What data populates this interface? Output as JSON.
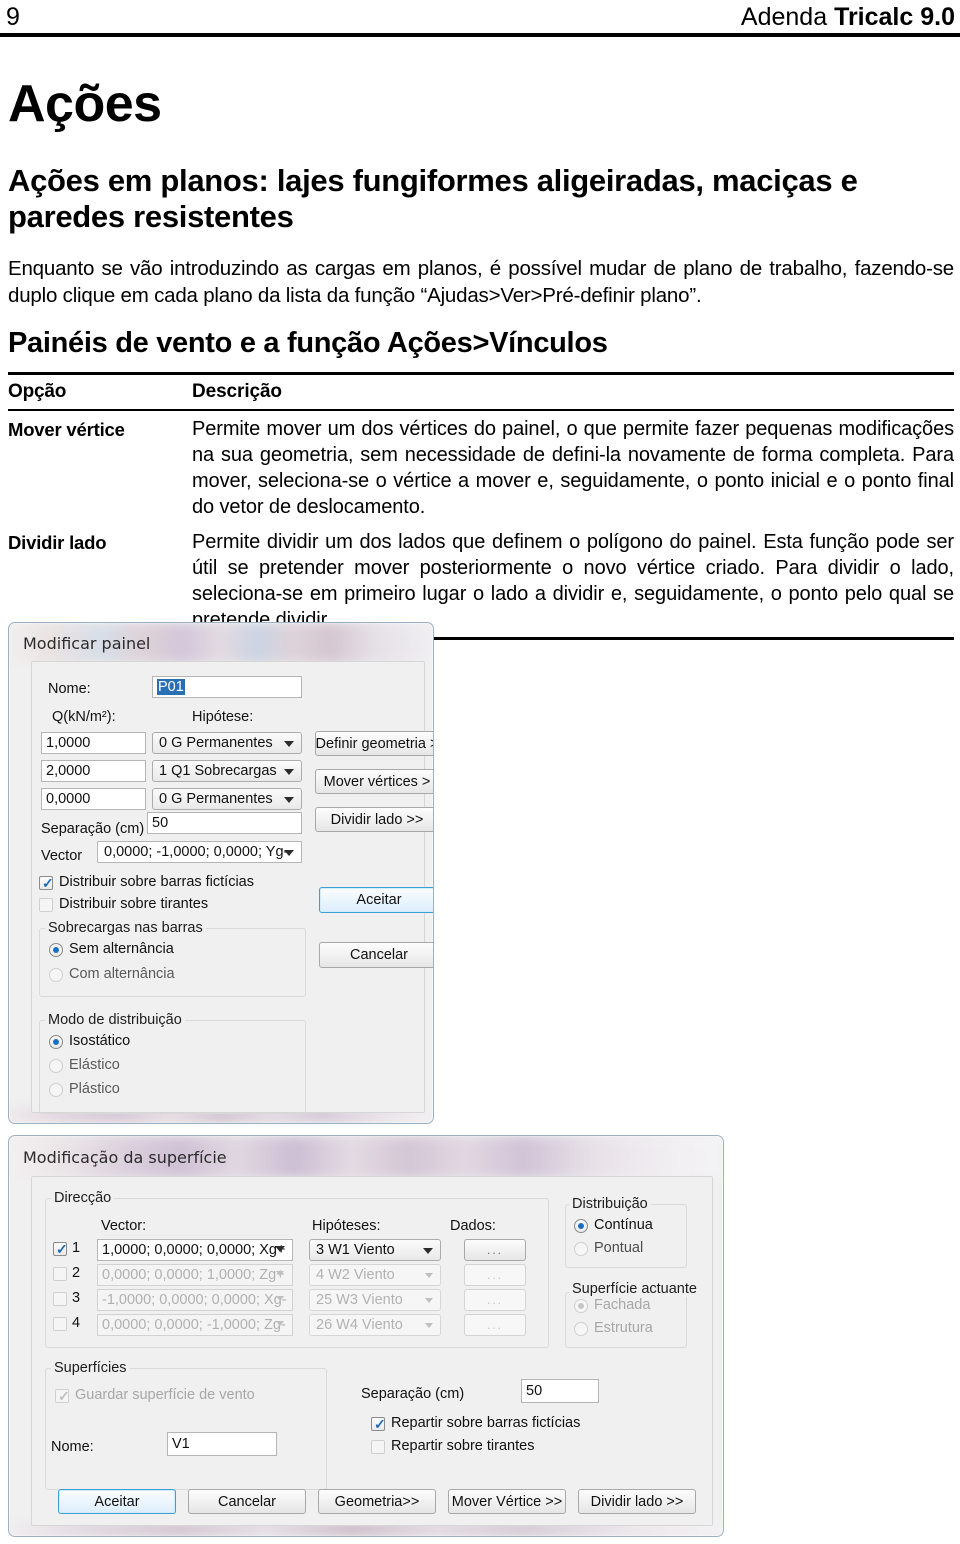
{
  "page": {
    "number": "9",
    "header_regular": "Adenda ",
    "header_bold": "Tricalc 9.0",
    "h1": "Ações",
    "h2": "Ações em planos: lajes fungiformes aligeiradas, maciças e paredes resistentes",
    "intro": "Enquanto se vão introduzindo as cargas em planos, é possível mudar de plano de trabalho, fazendo-se duplo clique em cada plano da lista da função “Ajudas>Ver>Pré-definir plano”.",
    "h3": "Painéis de vento e a função Ações>Vínculos"
  },
  "table": {
    "headers": [
      "Opção",
      "Descrição"
    ],
    "rows": [
      {
        "option": "Mover vértice",
        "description": "Permite mover um dos vértices do painel, o que permite fazer pequenas modificações na sua geometria, sem necessidade de defini-la novamente de forma completa. Para mover, seleciona-se o vértice a mover e, seguidamente, o ponto inicial e o ponto final do vetor de deslocamento."
      },
      {
        "option": "Dividir lado",
        "description": "Permite dividir um dos lados que definem o polígono do painel. Esta função pode ser útil se pretender mover posteriormente o novo vértice criado. Para dividir o lado, seleciona-se em primeiro lugar o lado a dividir e, seguidamente, o ponto pelo qual se pretende dividir."
      }
    ]
  },
  "dialog1": {
    "title": "Modificar painel",
    "nome_label": "Nome:",
    "nome_value": "P01",
    "q_label": "Q(kN/m²):",
    "hipotese_label": "Hipótese:",
    "loads": [
      {
        "q": "1,0000",
        "hipotese": "0 G   Permanentes"
      },
      {
        "q": "2,0000",
        "hipotese": "1 Q1  Sobrecargas"
      },
      {
        "q": "0,0000",
        "hipotese": "0 G   Permanentes"
      }
    ],
    "separacao_label": "Separação (cm)",
    "separacao_value": "50",
    "vector_label": "Vector",
    "vector_value": "0,0000; -1,0000; 0,0000; Yg-",
    "chk_barras_ficticias": "Distribuir sobre barras fictícias",
    "chk_tirantes": "Distribuir sobre tirantes",
    "grp_sobrecargas": "Sobrecargas nas barras",
    "rb_sem_alternancia": "Sem alternância",
    "rb_com_alternancia": "Com alternância",
    "grp_modo": "Modo de distribuição",
    "rb_isostatico": "Isostático",
    "rb_elastico": "Elástico",
    "rb_plastico": "Plástico",
    "btn_definir_geometria": "Definir geometria >",
    "btn_mover_vertices": "Mover vértices >",
    "btn_dividir_lado": "Dividir lado >>",
    "btn_aceitar": "Aceitar",
    "btn_cancelar": "Cancelar"
  },
  "dialog2": {
    "title": "Modificação da superfície",
    "grp_direccao": "Direcção",
    "col_vector": "Vector:",
    "col_hipoteses": "Hipóteses:",
    "col_dados": "Dados:",
    "rows": [
      {
        "index": "1",
        "checked": true,
        "vector": "1,0000; 0,0000; 0,0000; Xg+",
        "hipotese": "3 W1  Viento",
        "dados": "..."
      },
      {
        "index": "2",
        "checked": false,
        "vector": "0,0000; 0,0000; 1,0000; Zg+",
        "hipotese": "4 W2  Viento",
        "dados": "..."
      },
      {
        "index": "3",
        "checked": false,
        "vector": "-1,0000; 0,0000; 0,0000; Xg-",
        "hipotese": "25 W3  Viento",
        "dados": "..."
      },
      {
        "index": "4",
        "checked": false,
        "vector": "0,0000; 0,0000; -1,0000; Zg-",
        "hipotese": "26 W4  Viento",
        "dados": "..."
      }
    ],
    "grp_distribuicao": "Distribuição",
    "rb_continua": "Contínua",
    "rb_pontual": "Pontual",
    "grp_superficie_actuante": "Superfície actuante",
    "rb_fachada": "Fachada",
    "rb_estrutura": "Estrutura",
    "grp_superficies": "Superfícies",
    "chk_guardar": "Guardar superfície de vento",
    "nome_label": "Nome:",
    "nome_value": "V1",
    "separacao_label": "Separação (cm)",
    "separacao_value": "50",
    "chk_repartir_barras": "Repartir sobre barras fictícias",
    "chk_repartir_tirantes": "Repartir sobre tirantes",
    "btn_aceitar": "Aceitar",
    "btn_cancelar": "Cancelar",
    "btn_geometria": "Geometria>>",
    "btn_mover_vertice": "Mover Vértice >>",
    "btn_dividir_lado": "Dividir lado >>"
  }
}
